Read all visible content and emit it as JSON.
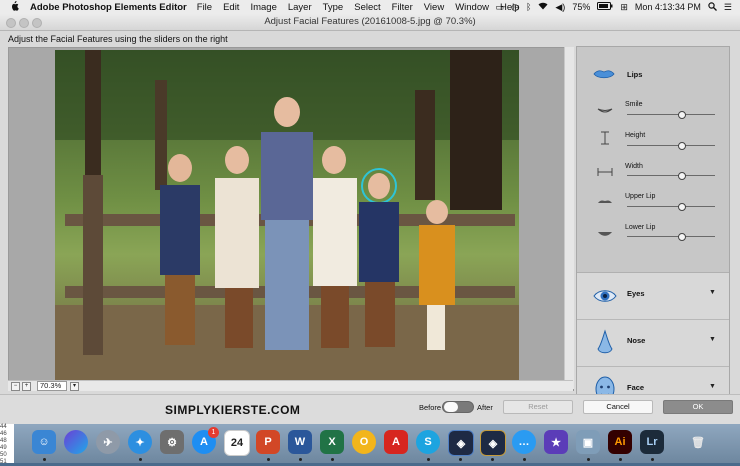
{
  "menubar": {
    "apple": "",
    "app_name": "Adobe Photoshop Elements Editor",
    "menus": [
      "File",
      "Edit",
      "Image",
      "Layer",
      "Type",
      "Select",
      "Filter",
      "View",
      "Window",
      "Help"
    ],
    "battery": "75%",
    "clock": "Mon 4:13:34 PM"
  },
  "window": {
    "title": "Adjust Facial Features (20161008-5.jpg @ 70.3%)",
    "instruction": "Adjust the Facial Features using the sliders on the right",
    "zoom": "70.3%"
  },
  "panel": {
    "lips": {
      "title": "Lips",
      "sliders": [
        {
          "label": "Smile",
          "value": 0.62
        },
        {
          "label": "Height",
          "value": 0.62
        },
        {
          "label": "Width",
          "value": 0.62
        },
        {
          "label": "Upper Lip",
          "value": 0.62
        },
        {
          "label": "Lower Lip",
          "value": 0.62
        }
      ]
    },
    "eyes": "Eyes",
    "nose": "Nose",
    "face": "Face",
    "arrow": "▼"
  },
  "footer": {
    "watermark": "SIMPLYKIERSTE.COM",
    "before": "Before",
    "after": "After",
    "reset": "Reset",
    "cancel": "Cancel",
    "ok": "OK"
  },
  "dock": {
    "sheet_rows": [
      "44",
      "46",
      "48",
      "49",
      "50",
      "51"
    ],
    "calendar_day": "24",
    "badge": "1",
    "apps": [
      "finder",
      "siri",
      "launchpad",
      "safari",
      "system-preferences",
      "app-store",
      "calendar",
      "powerpoint",
      "word",
      "excel",
      "slides",
      "acrobat",
      "skype",
      "premiere-elements",
      "photoshop-elements",
      "messages",
      "imovie",
      "preview",
      "illustrator",
      "lightroom",
      "trash"
    ]
  },
  "colors": {
    "face_ring": "#2ec4d6",
    "accent_blue": "#2f6fbf"
  }
}
